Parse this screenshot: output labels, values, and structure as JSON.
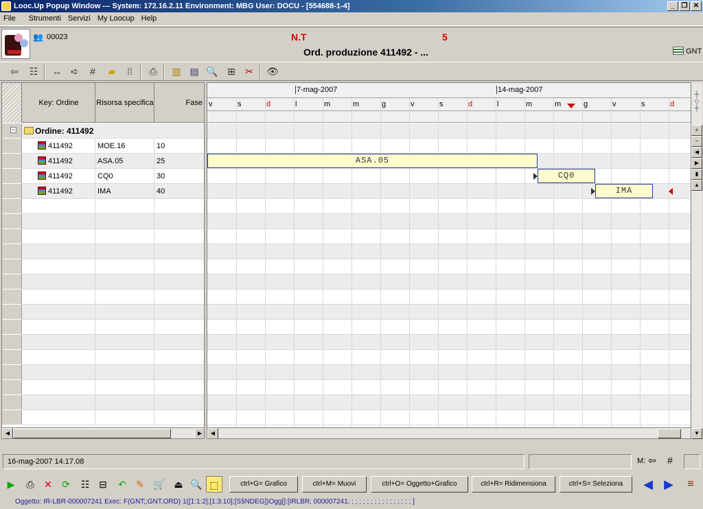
{
  "window": {
    "title": "Looc.Up Popup Window  ---  System: 172.16.2.11 Environment: MBG User: DOCU - [554688-1-4]"
  },
  "menu": [
    "File",
    "Strumenti",
    "Servizi",
    "My Loocup",
    "Help"
  ],
  "header": {
    "code": "00023",
    "nt_label": "N.T",
    "nt_value": "5",
    "title": "Ord. produzione 411492 - ...",
    "gnt_label": "GNT"
  },
  "grid": {
    "columns": [
      "Key: Ordine",
      "Risorsa specifica",
      "Fase"
    ],
    "group_label": "Ordine: 411492",
    "rows": [
      {
        "key": "411492",
        "risorsa": "MOE.16",
        "fase": "10"
      },
      {
        "key": "411492",
        "risorsa": "ASA.05",
        "fase": "25"
      },
      {
        "key": "411492",
        "risorsa": "CQ0",
        "fase": "30"
      },
      {
        "key": "411492",
        "risorsa": "IMA",
        "fase": "40"
      }
    ]
  },
  "gantt": {
    "week_labels": [
      "7-mag-2007",
      "14-mag-2007"
    ],
    "days": [
      "v",
      "s",
      "d",
      "l",
      "m",
      "m",
      "g",
      "v",
      "s",
      "d",
      "l",
      "m",
      "m",
      "g",
      "v",
      "s",
      "d"
    ],
    "bars": [
      "ASA.05",
      "CQ0",
      "IMA"
    ]
  },
  "status": {
    "datetime": "16-mag-2007 14.17.08",
    "mode": "M:"
  },
  "shortcuts": [
    "ctrl+G= Grafico",
    "ctrl+M= Muovi",
    "ctrl+O= Oggetto+Grafico",
    "ctrl+R= Ridimensiona",
    "ctrl+S= Seleziona"
  ],
  "oggetto": "Oggetto: IR-LBR-000007241 Exec: F(GNT;;GNT.ORD) 1([1:1:2];[1:3:10];[S§NDEG])Ogg[]:[IRLBR; 000007241; ; ; ; ; ; ; ; ; ; ; ; ; ; ; ; ; ]",
  "colors": {
    "title_bar": "#0a246a",
    "bar_fill": "#fffccc",
    "bar_border": "#1f3aa0",
    "weekend": "#cc0000"
  }
}
